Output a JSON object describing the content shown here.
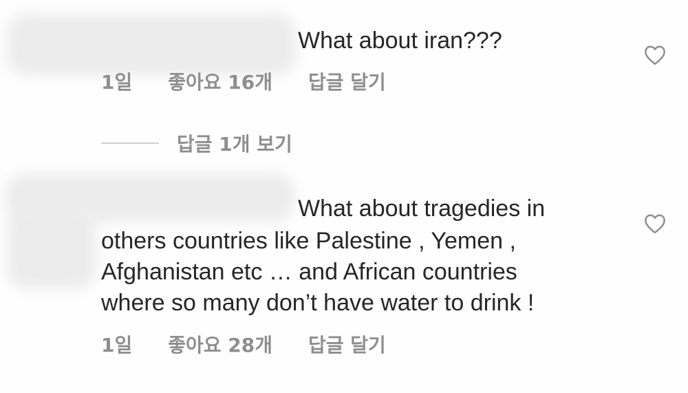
{
  "comments": [
    {
      "text_lines": [
        "What about iran???"
      ],
      "time": "1일",
      "likes": "좋아요 16개",
      "reply_label": "답글 달기"
    },
    {
      "text_lines": [
        "What about tragedies in",
        "others countries like Palestine , Yemen ,",
        "Afghanistan etc … and African countries",
        "where so many don’t have water to drink !"
      ],
      "time": "1일",
      "likes": "좋아요 28개",
      "reply_label": "답글 달기"
    }
  ],
  "view_replies": {
    "label": "답글 1개 보기"
  },
  "icons": {
    "like": "heart-outline-icon"
  },
  "colors": {
    "text": "#262626",
    "meta": "#8e8e8e",
    "heart_stroke": "#8e8e8e"
  }
}
